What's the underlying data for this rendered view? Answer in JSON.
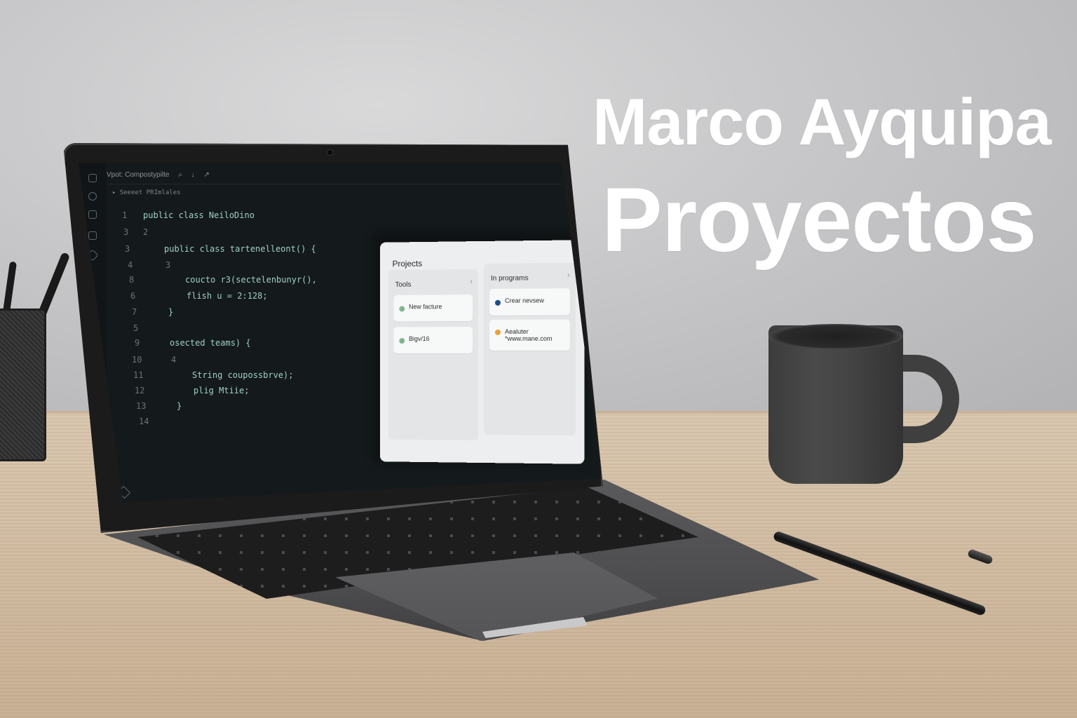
{
  "headline": {
    "line1": "Marco Ayquipa",
    "line2": "Proyectos"
  },
  "editor": {
    "title_items": [
      "Vpot: Compostypilte",
      "⌕",
      "↓",
      "↗"
    ],
    "breadcrumb": "▸  Seeeet PRImlales",
    "lines": [
      {
        "n": "1",
        "code": "public class NeiloDino"
      },
      {
        "n": "3",
        "code": "2"
      },
      {
        "n": "3",
        "code": "public class tartenelleont() {"
      },
      {
        "n": "4",
        "code": "3"
      },
      {
        "n": "8",
        "code": "coucto r3(sectelenbunyr(),"
      },
      {
        "n": "6",
        "code": "flish u = 2:128;"
      },
      {
        "n": "7",
        "code": "}"
      },
      {
        "n": "5",
        "code": ""
      },
      {
        "n": "9",
        "code": "osected teams) {"
      },
      {
        "n": "10",
        "code": "4"
      },
      {
        "n": "11",
        "code": "String coupossbrve);"
      },
      {
        "n": "12",
        "code": "plig Mtiie;"
      },
      {
        "n": "13",
        "code": "}"
      },
      {
        "n": "14",
        "code": ""
      }
    ]
  },
  "projects": {
    "title": "Projects",
    "columns": [
      {
        "header": "Tools",
        "cards": [
          {
            "label": "New facture",
            "dot_color": "#7fb58e"
          },
          {
            "label": "Bigv/16",
            "dot_color": "#7fb58e"
          }
        ]
      },
      {
        "header": "In programs",
        "cards": [
          {
            "label": "Crear nevsew",
            "dot_color": "#1f4d8a"
          },
          {
            "label": "Aealuter",
            "sub": "*www.mane.com",
            "dot_color": "#e8a23a"
          }
        ]
      }
    ]
  }
}
